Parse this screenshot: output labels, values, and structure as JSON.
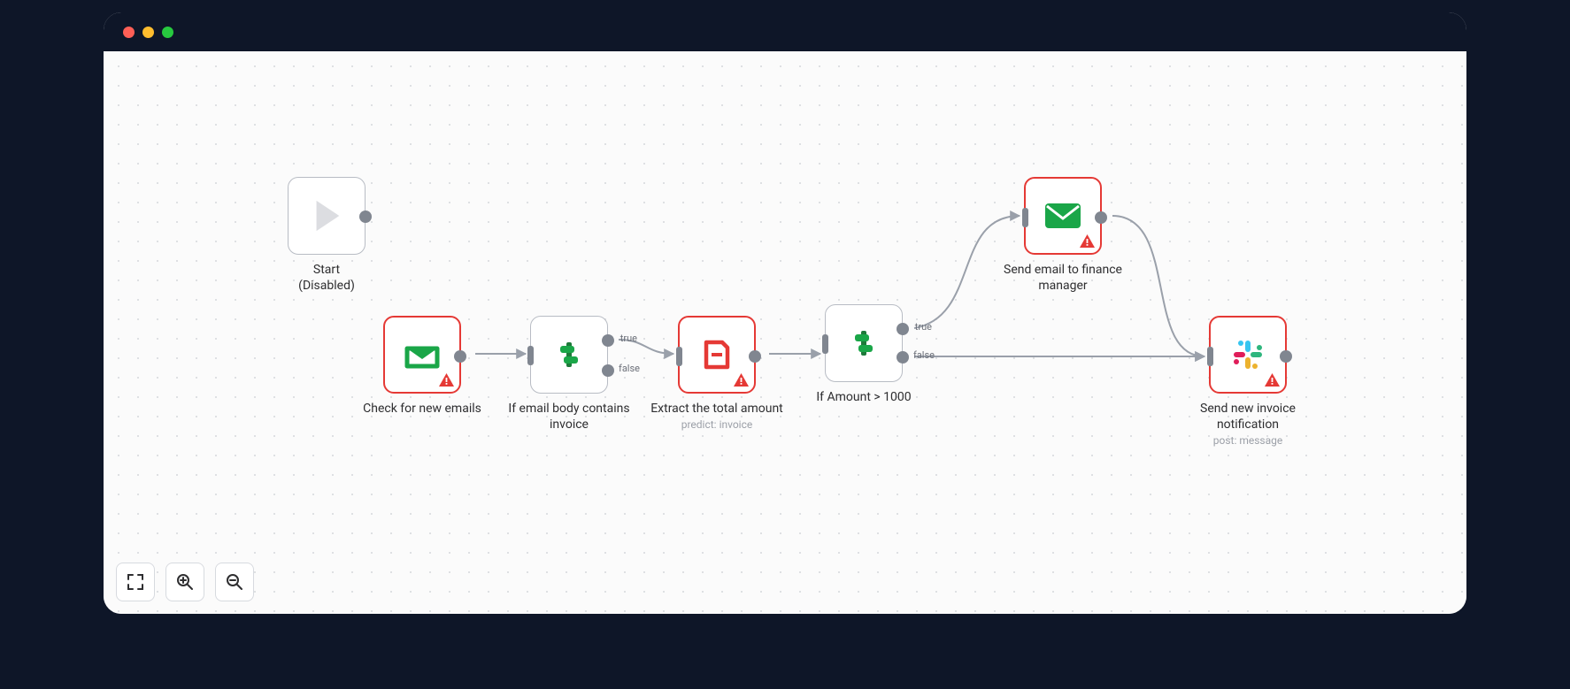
{
  "nodes": {
    "start": {
      "label": "Start",
      "sublabel": "(Disabled)"
    },
    "check_emails": {
      "label": "Check for new emails"
    },
    "if_body": {
      "label": "If email body contains invoice"
    },
    "extract_total": {
      "label": "Extract the total amount",
      "sublabel": "predict: invoice"
    },
    "if_amount": {
      "label": "If Amount > 1000"
    },
    "send_email": {
      "label": "Send email to finance manager"
    },
    "send_slack": {
      "label": "Send new invoice notification",
      "sublabel": "post: message"
    }
  },
  "port_labels": {
    "true": "true",
    "false": "false"
  },
  "colors": {
    "error": "#e53935",
    "success_green": "#1aa648",
    "accent_red": "#e53935",
    "neutral_border": "#b8bcc4",
    "port": "#808690"
  }
}
